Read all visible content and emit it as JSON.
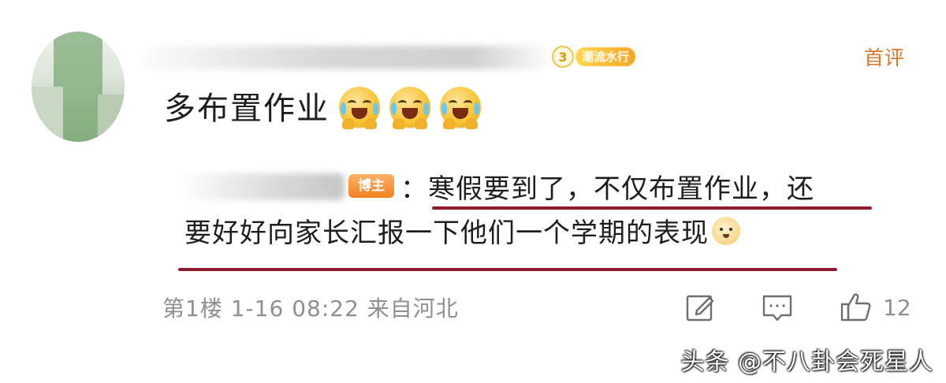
{
  "comment": {
    "first_comment_label": "首评",
    "level_number": "3",
    "level_tag": "潮流水行",
    "text": "多布置作业"
  },
  "reply": {
    "blogger_badge": "博主",
    "separator": "：",
    "line1": "寒假要到了，不仅布置作业，还",
    "line2": "要好好向家长汇报一下他们一个学期的表现"
  },
  "meta": {
    "floor": "第1楼",
    "date": "1-16",
    "time": "08:22",
    "location": "来自河北",
    "like_count": "12"
  },
  "icons": {
    "reply": "edit-icon",
    "comment": "comment-icon",
    "like": "thumbs-up-icon"
  },
  "watermark": "头条 @不八卦会死星人",
  "colors": {
    "accent_orange": "#d9772b",
    "underline_red": "#8e1a2a",
    "meta_gray": "#8f8f8f"
  }
}
